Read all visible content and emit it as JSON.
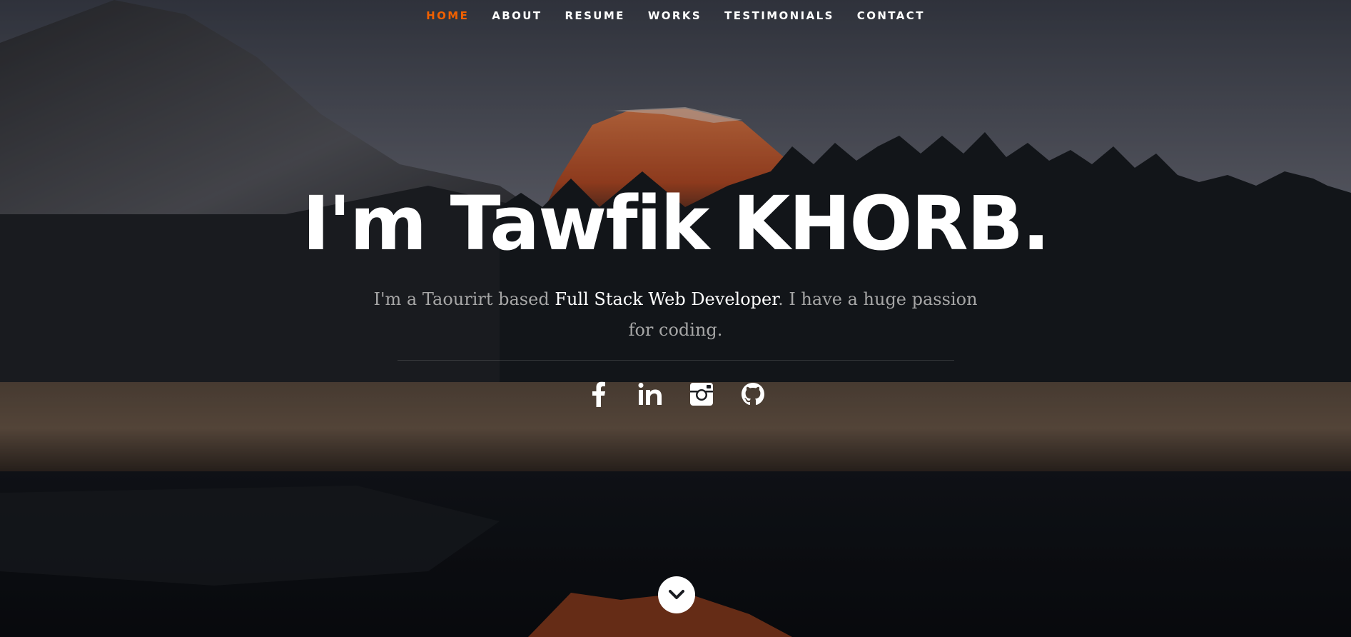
{
  "nav": {
    "items": [
      {
        "label": "HOME",
        "active": true
      },
      {
        "label": "ABOUT"
      },
      {
        "label": "RESUME"
      },
      {
        "label": "WORKS"
      },
      {
        "label": "TESTIMONIALS"
      },
      {
        "label": "CONTACT"
      }
    ],
    "active_color": "#F06000"
  },
  "banner": {
    "headline": "I'm Tawfik KHORB.",
    "intro_prefix": "I'm a Taourirt based ",
    "intro_role": "Full Stack Web Developer",
    "intro_suffix": ". I have a huge passion for coding."
  },
  "social": [
    {
      "icon": "facebook-icon"
    },
    {
      "icon": "linkedin-icon"
    },
    {
      "icon": "instagram-icon"
    },
    {
      "icon": "github-icon"
    }
  ],
  "scroll": {
    "icon": "chevron-down-icon"
  }
}
